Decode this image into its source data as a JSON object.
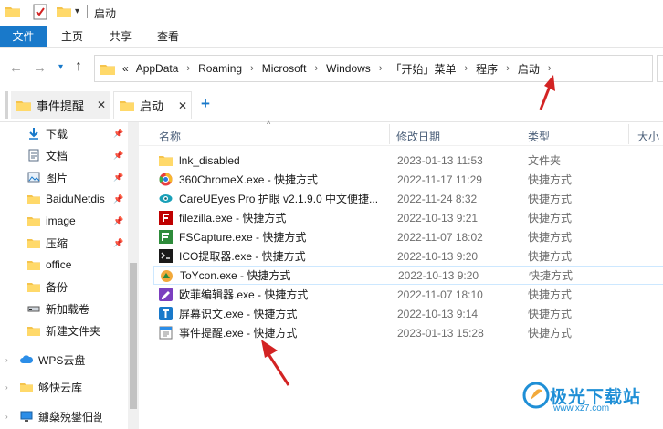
{
  "window": {
    "title": "启动"
  },
  "ribbon": {
    "tabs": [
      "文件",
      "主页",
      "共享",
      "查看"
    ]
  },
  "address": {
    "crumbs": [
      "«",
      "AppData",
      "Roaming",
      "Microsoft",
      "Windows",
      "「开始」菜单",
      "程序",
      "启动"
    ]
  },
  "folder_tabs": [
    {
      "label": "事件提醒"
    },
    {
      "label": "启动"
    }
  ],
  "sidebar": {
    "items": [
      {
        "label": "下载",
        "icon": "download-arrow-icon",
        "pinned": true
      },
      {
        "label": "文档",
        "icon": "document-icon",
        "pinned": true
      },
      {
        "label": "图片",
        "icon": "picture-icon",
        "pinned": true
      },
      {
        "label": "BaiduNetdis",
        "icon": "folder-icon",
        "pinned": true
      },
      {
        "label": "image",
        "icon": "folder-icon",
        "pinned": true
      },
      {
        "label": "压缩",
        "icon": "folder-icon",
        "pinned": true
      },
      {
        "label": "office",
        "icon": "folder-icon",
        "pinned": false
      },
      {
        "label": "备份",
        "icon": "folder-icon",
        "pinned": false
      },
      {
        "label": "新加载卷",
        "icon": "drive-icon",
        "pinned": false
      },
      {
        "label": "新建文件夹",
        "icon": "folder-icon",
        "pinned": false
      },
      {
        "label": "WPS云盘",
        "icon": "cloud-icon",
        "pinned": false
      },
      {
        "label": "够快云库",
        "icon": "folder-icon",
        "pinned": false
      },
      {
        "label": "鐪燊殑鐢佃剳",
        "icon": "computer-icon",
        "pinned": false
      }
    ]
  },
  "columns": {
    "name": "名称",
    "date": "修改日期",
    "type": "类型",
    "size": "大小"
  },
  "files": [
    {
      "name": "lnk_disabled",
      "date": "2023-01-13 11:53",
      "type": "文件夹",
      "icon": "folder-icon"
    },
    {
      "name": "360ChromeX.exe - 快捷方式",
      "date": "2022-11-17 11:29",
      "type": "快捷方式",
      "icon": "chrome-360-icon"
    },
    {
      "name": "CareUEyes Pro 护眼 v2.1.9.0 中文便捷...",
      "date": "2022-11-24 8:32",
      "type": "快捷方式",
      "icon": "eye-icon"
    },
    {
      "name": "filezilla.exe - 快捷方式",
      "date": "2022-10-13 9:21",
      "type": "快捷方式",
      "icon": "filezilla-icon"
    },
    {
      "name": "FSCapture.exe - 快捷方式",
      "date": "2022-11-07 18:02",
      "type": "快捷方式",
      "icon": "fscapture-icon"
    },
    {
      "name": "ICO提取器.exe - 快捷方式",
      "date": "2022-10-13 9:20",
      "type": "快捷方式",
      "icon": "ico-extractor-icon"
    },
    {
      "name": "ToYcon.exe - 快捷方式",
      "date": "2022-10-13 9:20",
      "type": "快捷方式",
      "icon": "toycon-icon"
    },
    {
      "name": "欧菲编辑器.exe - 快捷方式",
      "date": "2022-11-07 18:10",
      "type": "快捷方式",
      "icon": "editor-icon"
    },
    {
      "name": "屏幕识文.exe - 快捷方式",
      "date": "2022-10-13 9:14",
      "type": "快捷方式",
      "icon": "ocr-icon"
    },
    {
      "name": "事件提醒.exe - 快捷方式",
      "date": "2023-01-13 15:28",
      "type": "快捷方式",
      "icon": "reminder-icon"
    }
  ],
  "watermark": {
    "text": "极光下载站",
    "url": "www.xz7.com"
  },
  "colors": {
    "accent": "#1979ca",
    "folder": "#f5c44d",
    "arrow": "#d32323"
  }
}
